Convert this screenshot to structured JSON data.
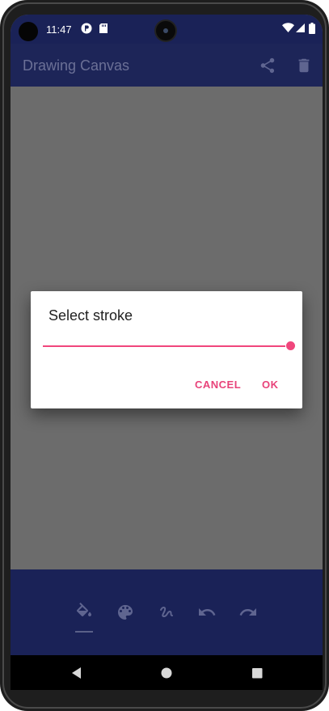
{
  "status_bar": {
    "time": "11:47",
    "icons": [
      "p-badge-icon",
      "sd-card-icon",
      "wifi-icon",
      "signal-icon",
      "battery-icon"
    ]
  },
  "app_bar": {
    "title": "Drawing Canvas",
    "actions": [
      "share-icon",
      "delete-icon"
    ]
  },
  "dialog": {
    "title": "Select stroke",
    "stroke_slider_value": 1.0,
    "cancel_label": "CANCEL",
    "ok_label": "OK"
  },
  "toolbar": {
    "tools": [
      "paint-bucket-icon",
      "palette-icon",
      "brush-stroke-icon",
      "undo-icon",
      "redo-icon"
    ],
    "selected": "paint-bucket-icon"
  },
  "navigation": [
    "back-icon",
    "home-icon",
    "recents-icon"
  ],
  "colors": {
    "app_bar": "#1d2558",
    "canvas": "#6c6c6c",
    "accent": "#e8437a"
  }
}
